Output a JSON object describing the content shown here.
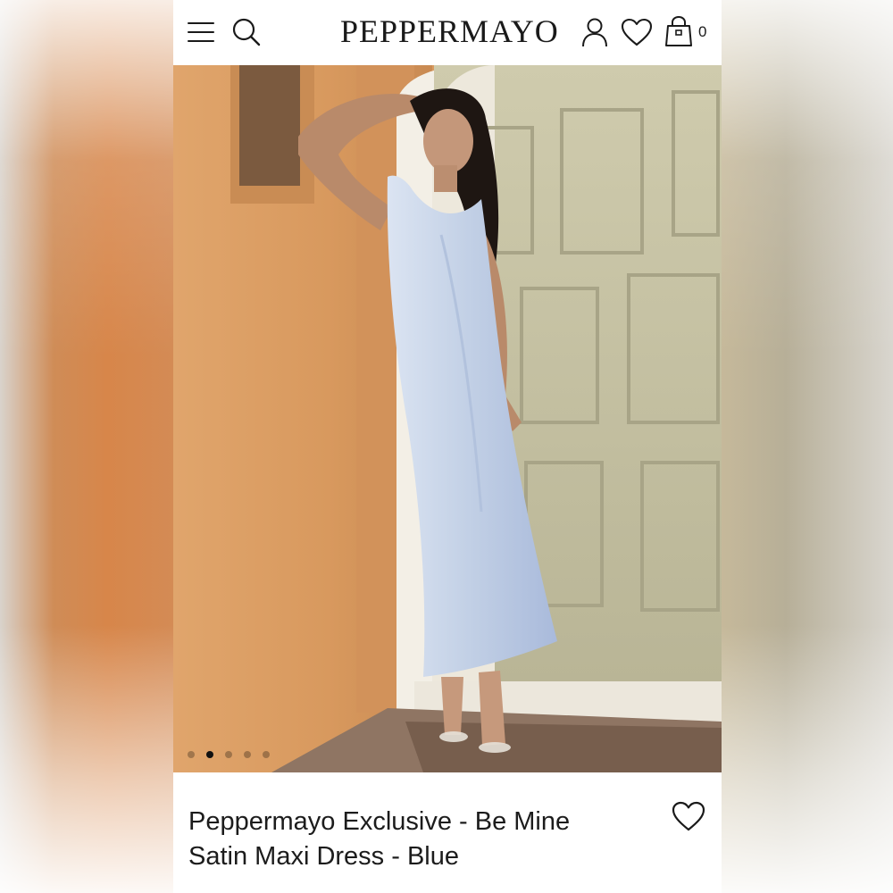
{
  "header": {
    "brand": "PEPPERMAYO",
    "menu_icon": "hamburger-menu-icon",
    "search_icon": "search-icon",
    "account_icon": "user-icon",
    "wishlist_icon": "heart-icon",
    "cart_icon": "shopping-bag-icon",
    "cart_count": "0"
  },
  "gallery": {
    "image_count": 5,
    "active_index": 1
  },
  "product": {
    "title": "Peppermayo Exclusive - Be Mine Satin Maxi Dress - Blue",
    "wishlist_icon": "heart-icon"
  },
  "colors": {
    "text": "#1a1a1a",
    "dress": "#c5d3e8",
    "wall": "#d99a60",
    "door": "#c2bea0"
  }
}
